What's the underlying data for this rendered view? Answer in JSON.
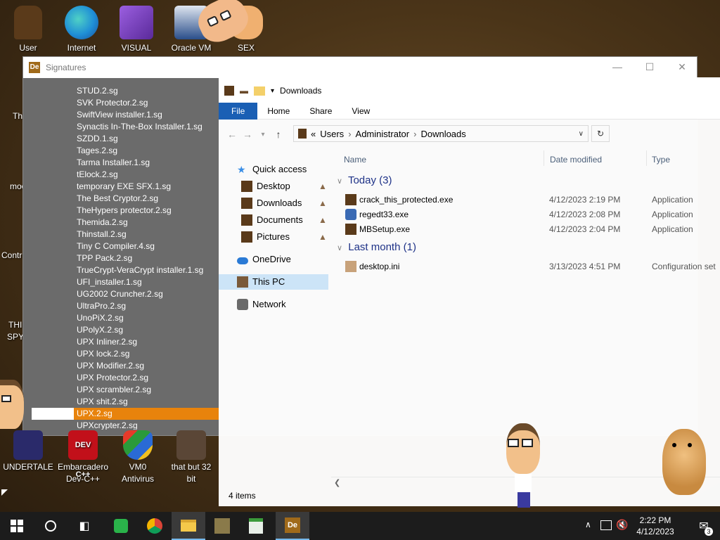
{
  "desktop": {
    "top_icons": [
      {
        "label": "User",
        "icon": "user-icon",
        "color": "#5a3a1a"
      },
      {
        "label": "Internet",
        "icon": "edge-browser-icon",
        "color": "#1f8ed6"
      },
      {
        "label": "VISUAL",
        "icon": "visual-studio-icon",
        "color": "#7b3fc7"
      },
      {
        "label": "Oracle VM",
        "icon": "virtualbox-icon",
        "color": "#2a4e8a"
      },
      {
        "label": "SEX",
        "icon": "cartoon-face-icon",
        "color": "#e0a060"
      }
    ],
    "left_labels": [
      "Th",
      "moo",
      "Contr",
      "THI",
      "SPY"
    ],
    "bottom_icons": [
      {
        "label": "UNDERTALE",
        "icon": "undertale-icon",
        "color": "#333"
      },
      {
        "label": "Embarcadero Dev-C++",
        "icon": "devcpp-icon",
        "color": "#c2101a"
      },
      {
        "label": "VM0 Antivirus",
        "icon": "shield-icon",
        "color": "#2a8a3a"
      },
      {
        "label": "that but 32 bit",
        "icon": "image-icon",
        "color": "#5a4636"
      }
    ]
  },
  "signatures": {
    "title": "Signatures",
    "items": [
      "STUD.2.sg",
      "SVK Protector.2.sg",
      "SwiftView installer.1.sg",
      "Synactis In-The-Box Installer.1.sg",
      "SZDD.1.sg",
      "Tages.2.sg",
      "Tarma Installer.1.sg",
      "tElock.2.sg",
      "temporary EXE SFX.1.sg",
      "The Best Cryptor.2.sg",
      "TheHypers protector.2.sg",
      "Themida.2.sg",
      "Thinstall.2.sg",
      "Tiny C Compiler.4.sg",
      "TPP Pack.2.sg",
      "TrueCrypt-VeraCrypt installer.1.sg",
      "UFI_installer.1.sg",
      "UG2002 Cruncher.2.sg",
      "UltraPro.2.sg",
      "UnoPiX.2.sg",
      "UPolyX.2.sg",
      "UPX Inliner.2.sg",
      "UPX lock.2.sg",
      "UPX Modifier.2.sg",
      "UPX Protector.2.sg",
      "UPX scrambler.2.sg",
      "UPX shit.2.sg",
      "UPX.2.sg",
      "UPXcrypter.2.sg"
    ],
    "selected_index": 27
  },
  "explorer": {
    "qat_title": "Downloads",
    "ribbon_tabs": [
      "File",
      "Home",
      "Share",
      "View"
    ],
    "breadcrumb": [
      "Users",
      "Administrator",
      "Downloads"
    ],
    "breadcrumb_prefix": "«",
    "nav": {
      "quick_access": "Quick access",
      "pinned": [
        "Desktop",
        "Downloads",
        "Documents",
        "Pictures"
      ],
      "onedrive": "OneDrive",
      "this_pc": "This PC",
      "network": "Network"
    },
    "columns": {
      "name": "Name",
      "date": "Date modified",
      "type": "Type"
    },
    "groups": [
      {
        "header": "Today (3)",
        "files": [
          {
            "name": "crack_this_protected.exe",
            "date": "4/12/2023 2:19 PM",
            "type": "Application"
          },
          {
            "name": "regedt33.exe",
            "date": "4/12/2023 2:08 PM",
            "type": "Application"
          },
          {
            "name": "MBSetup.exe",
            "date": "4/12/2023 2:04 PM",
            "type": "Application"
          }
        ]
      },
      {
        "header": "Last month (1)",
        "files": [
          {
            "name": "desktop.ini",
            "date": "3/13/2023 4:51 PM",
            "type": "Configuration set"
          }
        ]
      }
    ],
    "status": "4 items"
  },
  "taskbar": {
    "time": "2:22 PM",
    "date": "4/12/2023",
    "notification_count": "3",
    "colors": {
      "bg": "#1c1c1c",
      "accent": "#76b9ed"
    }
  }
}
